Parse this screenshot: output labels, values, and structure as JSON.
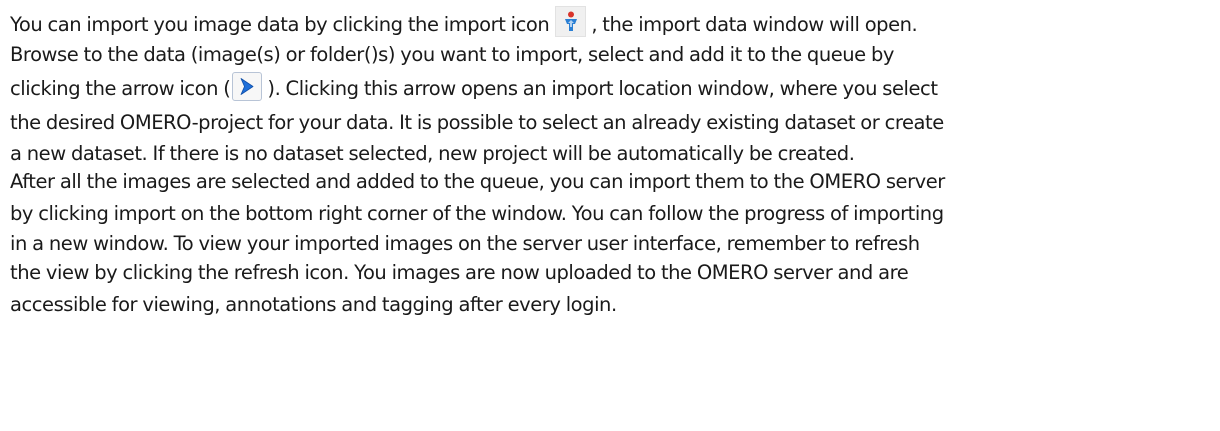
{
  "paragraph": {
    "lines": [
      [
        "You can import you image data by clicking the import icon",
        ", the import data window will open."
      ],
      [
        "Browse to the data (image(s) or folder()s) you want to import, select and add it to the queue by"
      ],
      [
        "clicking the arrow icon (",
        ").  Clicking this arrow opens an import location window, where you select"
      ],
      [
        "the desired OMERO-project for your data. It is possible to select an already existing dataset or create"
      ],
      [
        "a new dataset. If there is no dataset selected, new project will be automatically be created."
      ],
      [
        "After all the images are selected and added to the queue, you can import them to the OMERO server"
      ],
      [
        "by clicking import on the bottom right corner of the window. You can follow the progress of importing"
      ],
      [
        "in a new window. To view your imported images on the server user interface, remember to refresh"
      ],
      [
        "the view by clicking the refresh icon. You images are now uploaded to the OMERO server and are"
      ],
      [
        "accessible for viewing, annotations and tagging after every login."
      ]
    ]
  },
  "icons": {
    "import": "import-icon",
    "arrow": "arrow-right-icon"
  },
  "colors": {
    "text": "#1a1a1a",
    "arrow_icon": "#1e6fd9",
    "import_icon_body": "#2a7fd4",
    "import_icon_head": "#d9342b"
  }
}
